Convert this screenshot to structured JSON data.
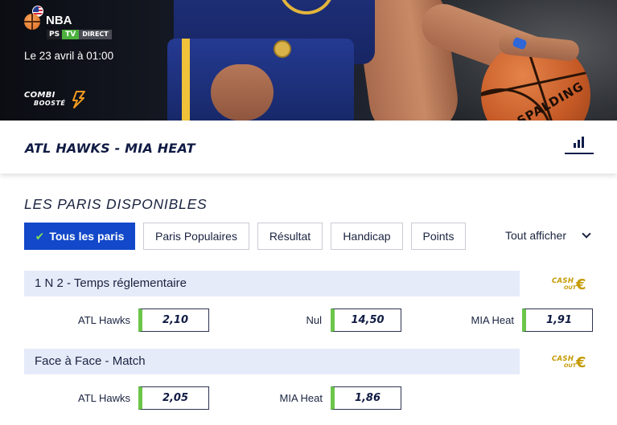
{
  "hero": {
    "league": "NBA",
    "channels": {
      "ps": "PS",
      "tv": "TV",
      "direct": "DIRECT"
    },
    "date_text": "Le 23 avril à 01:00",
    "combi": {
      "line1": "COMBI",
      "line2": "BOOSTÉ"
    },
    "ball_brand": "SPALDING"
  },
  "match": {
    "title": "ATL HAWKS - MIA HEAT",
    "stats_icon": "bar-chart-icon"
  },
  "bets": {
    "section_title": "LES PARIS DISPONIBLES",
    "filters": [
      {
        "label": "Tous les paris",
        "active": true
      },
      {
        "label": "Paris Populaires",
        "active": false
      },
      {
        "label": "Résultat",
        "active": false
      },
      {
        "label": "Handicap",
        "active": false
      },
      {
        "label": "Points",
        "active": false
      }
    ],
    "show_all": "Tout afficher",
    "markets": [
      {
        "title": "1 N 2 - Temps réglementaire",
        "cashout": {
          "line1": "CASH",
          "line2": "OUT",
          "symbol": "€"
        },
        "selections": [
          {
            "label": "ATL Hawks",
            "odd": "2,10"
          },
          {
            "label": "Nul",
            "odd": "14,50"
          },
          {
            "label": "MIA Heat",
            "odd": "1,91"
          }
        ]
      },
      {
        "title": "Face à Face - Match",
        "cashout": {
          "line1": "CASH",
          "line2": "OUT",
          "symbol": "€"
        },
        "selections": [
          {
            "label": "ATL Hawks",
            "odd": "2,05"
          },
          {
            "label": "MIA Heat",
            "odd": "1,86"
          }
        ]
      }
    ]
  },
  "colors": {
    "primary": "#1248c9",
    "odd_accent": "#6bc64a",
    "market_bar": "#e6ebfa",
    "cashout_gold": "#c49a00",
    "title_navy": "#101b44"
  }
}
